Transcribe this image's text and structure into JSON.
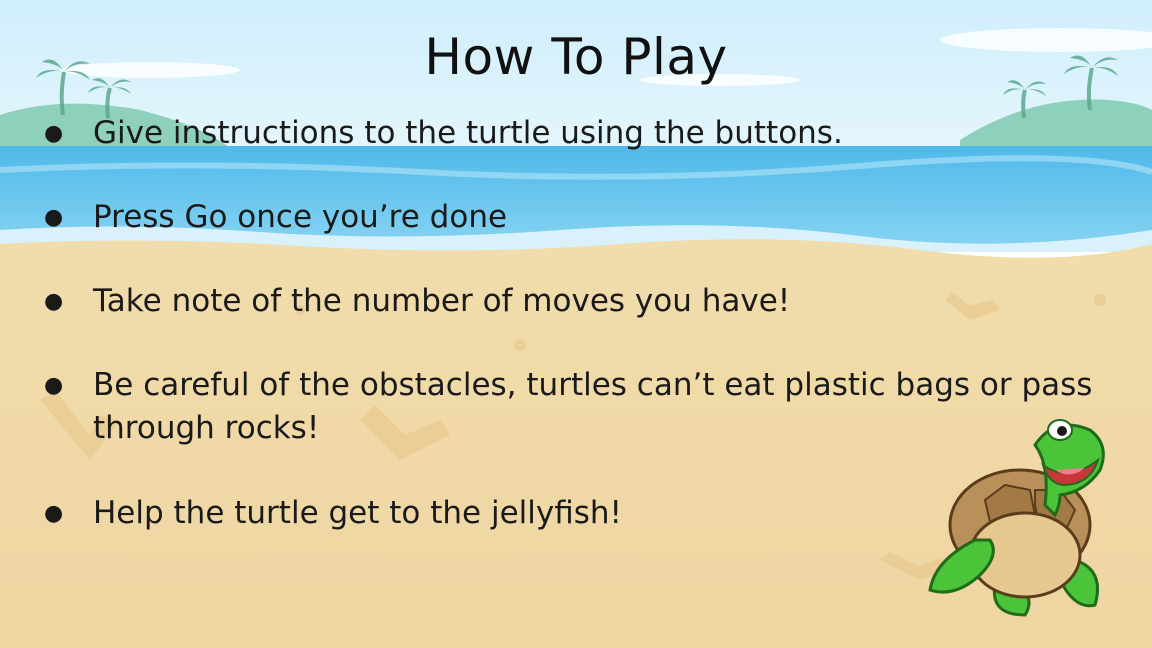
{
  "slide": {
    "title": "How To Play",
    "rules": [
      "Give instructions to the turtle using the buttons.",
      "Press Go once you’re done",
      "Take note of the number of moves you have!",
      "Be careful of the obstacles, turtles can’t eat plastic bags or pass through rocks!",
      "Help the turtle get to the jellyfish!"
    ],
    "bullet": "●"
  },
  "colors": {
    "sky": "#bfe4f7",
    "sea": "#5fc3ef",
    "sand": "#f0d9a6",
    "turtle_green": "#4cc43a",
    "shell": "#b9905a"
  },
  "icons": {
    "mascot": "turtle-illustration"
  }
}
